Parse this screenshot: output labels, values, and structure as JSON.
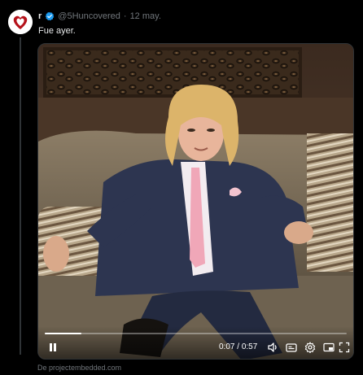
{
  "tweet": {
    "display_name": "r",
    "handle": "@5Huncovered",
    "separator": "·",
    "date": "12 may.",
    "text": "Fue ayer."
  },
  "video": {
    "elapsed": "0:07",
    "time_separator": "/",
    "duration": "0:57",
    "progress_fraction": 0.12
  },
  "footer": {
    "source": "De projectembedded.com"
  },
  "colors": {
    "background": "#000000",
    "text_primary": "#e7e9ea",
    "text_secondary": "#71767b",
    "verified_badge": "#1d9bf0",
    "avatar_heart": "#b5121b"
  },
  "icons": {
    "avatar": "heart-avatar-icon",
    "verified": "verified-badge-icon",
    "play": "pause-icon",
    "volume": "volume-icon",
    "captions": "captions-icon",
    "settings": "gear-icon",
    "pip": "picture-in-picture-icon",
    "fullscreen": "fullscreen-icon"
  }
}
